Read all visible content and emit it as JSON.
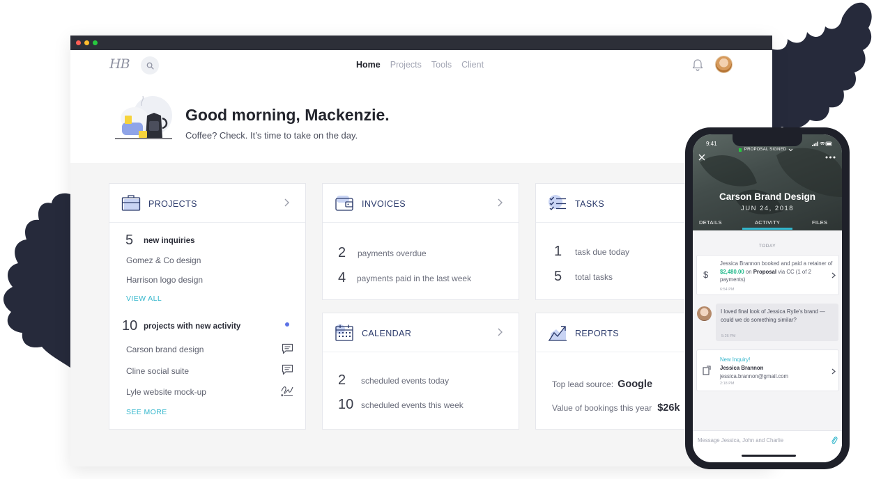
{
  "window": {
    "traffic_lights": [
      "#ff5f56",
      "#ffbd2e",
      "#27c93f"
    ]
  },
  "nav": {
    "logo": "HB",
    "links": [
      "Home",
      "Projects",
      "Tools",
      "Client"
    ],
    "active_link": "Home",
    "icons": [
      "search-icon",
      "bell-icon",
      "avatar"
    ]
  },
  "hero": {
    "greeting": "Good morning, Mackenzie.",
    "subtitle": "Coffee? Check. It’s time to take on the day."
  },
  "projects": {
    "title": "PROJECTS",
    "inquiries_count": "5",
    "inquiries_label": "new inquiries",
    "inquiries_items": [
      "Gomez & Co design",
      "Harrison logo design"
    ],
    "view_all": "VIEW ALL",
    "activity_count": "10",
    "activity_label": "projects with new activity",
    "activity_items": [
      {
        "name": "Carson brand design",
        "icon": "chat-icon"
      },
      {
        "name": "Cline social suite",
        "icon": "chat-icon"
      },
      {
        "name": "Lyle website mock-up",
        "icon": "signature-icon"
      }
    ],
    "see_more": "SEE MORE"
  },
  "invoices": {
    "title": "INVOICES",
    "stats": [
      {
        "value": "2",
        "label": "payments overdue"
      },
      {
        "value": "4",
        "label": "payments paid in the last week"
      }
    ]
  },
  "tasks": {
    "title": "TASKS",
    "stats": [
      {
        "value": "1",
        "label": "task due today"
      },
      {
        "value": "5",
        "label": "total tasks"
      }
    ]
  },
  "calendar": {
    "title": "CALENDAR",
    "stats": [
      {
        "value": "2",
        "label": "scheduled events today"
      },
      {
        "value": "10",
        "label": "scheduled events this week"
      }
    ]
  },
  "reports": {
    "title": "REPORTS",
    "lead_label": "Top lead source:",
    "lead_value": "Google",
    "bookings_label": "Value of bookings this year",
    "bookings_value": "$26k"
  },
  "phone": {
    "time": "9:41",
    "status": "PROPOSAL SIGNED",
    "project_title": "Carson Brand Design",
    "date": "JUN 24, 2018",
    "tabs": [
      "DETAILS",
      "ACTIVITY",
      "FILES"
    ],
    "active_tab": "ACTIVITY",
    "today_label": "TODAY",
    "msg1": {
      "pre": "Jessica Brannon booked and paid a retainer of ",
      "amount": "$2,480.00",
      "mid": " on ",
      "doc": "Proposal",
      "post": " via CC (1 of 2 payments)",
      "time": "6:54 PM"
    },
    "msg2": {
      "text": "I loved final look of Jessica Rylie’s brand — could we do something similar?",
      "time": "5:26 PM"
    },
    "msg3": {
      "label": "New Inquiry!",
      "name": "Jessica Brannon",
      "email": "jessica.brannon@gmail.com",
      "time": "2:18 PM"
    },
    "input_placeholder": "Message Jessica, John and Charlie"
  },
  "colors": {
    "accent_teal": "#33b6cc",
    "money_green": "#1fb88a",
    "navy_title": "#2b3a6b",
    "leaf_dark": "#262a3b",
    "active_dot": "#5c72e6"
  }
}
